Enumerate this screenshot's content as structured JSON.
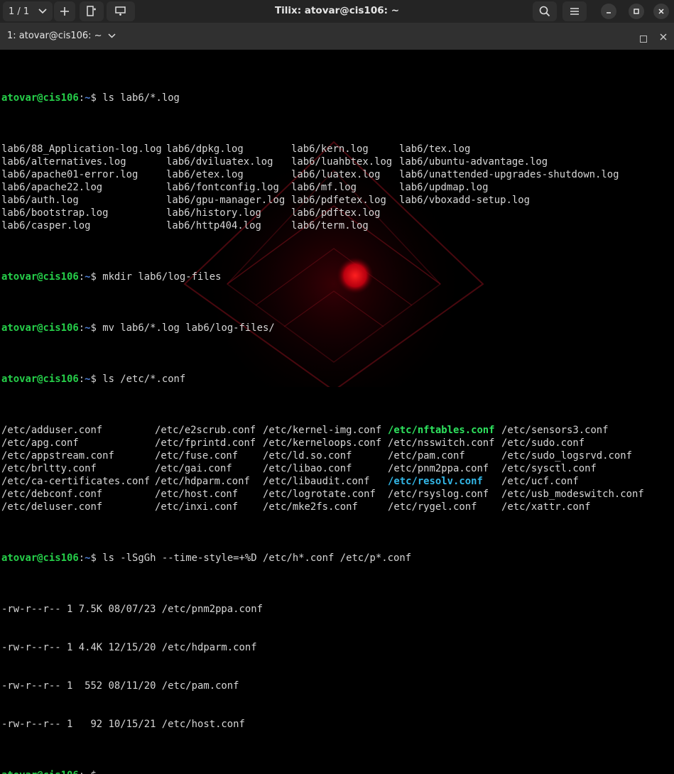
{
  "window": {
    "session_label": "1 / 1",
    "title": "Tilix: atovar@cis106: ~",
    "icons": [
      "chevron-down-icon",
      "plus-icon",
      "split-right-icon",
      "split-down-icon",
      "search-icon",
      "hamburger-menu-icon",
      "minimize-icon",
      "maximize-icon",
      "close-icon"
    ]
  },
  "terminal": {
    "tab_title": "1: atovar@cis106: ~",
    "prompt_user": "atovar@cis106",
    "prompt_path": "~",
    "prompt_sep": ":",
    "prompt_end": "$ ",
    "cmd1": "ls lab6/*.log",
    "log_cols": [
      [
        "lab6/88_Application-log.log",
        "lab6/alternatives.log",
        "lab6/apache01-error.log",
        "lab6/apache22.log",
        "lab6/auth.log",
        "lab6/bootstrap.log",
        "lab6/casper.log"
      ],
      [
        "lab6/dpkg.log",
        "lab6/dviluatex.log",
        "lab6/etex.log",
        "lab6/fontconfig.log",
        "lab6/gpu-manager.log",
        "lab6/history.log",
        "lab6/http404.log"
      ],
      [
        "lab6/kern.log",
        "lab6/luahbtex.log",
        "lab6/luatex.log",
        "lab6/mf.log",
        "lab6/pdfetex.log",
        "lab6/pdftex.log",
        "lab6/term.log"
      ],
      [
        "lab6/tex.log",
        "lab6/ubuntu-advantage.log",
        "lab6/unattended-upgrades-shutdown.log",
        "lab6/updmap.log",
        "lab6/vboxadd-setup.log",
        "",
        ""
      ]
    ],
    "cmd2": "mkdir lab6/log-files",
    "cmd3": "mv lab6/*.log lab6/log-files/",
    "cmd4": "ls /etc/*.conf",
    "conf_cols": [
      [
        "/etc/adduser.conf",
        "/etc/apg.conf",
        "/etc/appstream.conf",
        "/etc/brltty.conf",
        "/etc/ca-certificates.conf",
        "/etc/debconf.conf",
        "/etc/deluser.conf"
      ],
      [
        "/etc/e2scrub.conf",
        "/etc/fprintd.conf",
        "/etc/fuse.conf",
        "/etc/gai.conf",
        "/etc/hdparm.conf",
        "/etc/host.conf",
        "/etc/inxi.conf"
      ],
      [
        "/etc/kernel-img.conf",
        "/etc/kerneloops.conf",
        "/etc/ld.so.conf",
        "/etc/libao.conf",
        "/etc/libaudit.conf",
        "/etc/logrotate.conf",
        "/etc/mke2fs.conf"
      ],
      [
        "/etc/nftables.conf",
        "/etc/nsswitch.conf",
        "/etc/pam.conf",
        "/etc/pnm2ppa.conf",
        "/etc/resolv.conf",
        "/etc/rsyslog.conf",
        "/etc/rygel.conf"
      ],
      [
        "/etc/sensors3.conf",
        "/etc/sudo.conf",
        "/etc/sudo_logsrvd.conf",
        "/etc/sysctl.conf",
        "/etc/ucf.conf",
        "/etc/usb_modeswitch.conf",
        "/etc/xattr.conf"
      ]
    ],
    "cmd5": "ls -lSgGh --time-style=+%D /etc/h*.conf /etc/p*.conf",
    "long_listing": [
      "-rw-r--r-- 1 7.5K 08/07/23 /etc/pnm2ppa.conf",
      "-rw-r--r-- 1 4.4K 12/15/20 /etc/hdparm.conf",
      "-rw-r--r-- 1  552 08/11/20 /etc/pam.conf",
      "-rw-r--r-- 1   92 10/15/21 /etc/host.conf"
    ],
    "cursor": "_",
    "colors": {
      "user": "#26d04a",
      "path": "#4d7fd6",
      "executable_green": "#2ee35e",
      "symlink_cyan": "#33b8e8",
      "text": "#d6d6d6"
    }
  }
}
